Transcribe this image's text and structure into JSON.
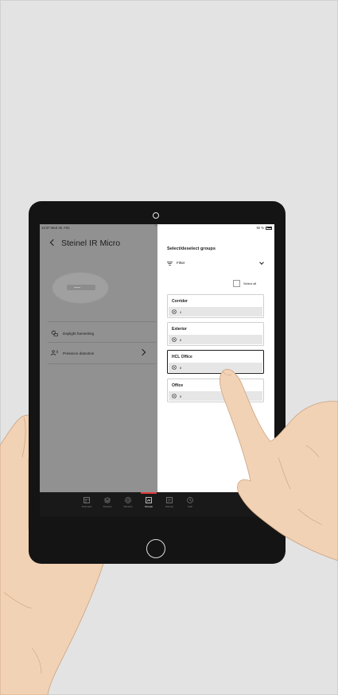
{
  "status_bar": {
    "time_date": "13:37  Wed 26. Feb",
    "battery": "92 %",
    "dots": "•••"
  },
  "left_panel": {
    "title": "Steinel IR Micro",
    "menu": [
      {
        "label": "Daylight harvesting",
        "icon": "daylight-harvesting-icon"
      },
      {
        "label": "Presence detection",
        "icon": "presence-detection-icon"
      }
    ]
  },
  "right_panel": {
    "title": "Select/deselect groups",
    "filter_label": "Filter",
    "select_all_label": "Select all",
    "groups": [
      {
        "name": "Corridor",
        "count": "4",
        "selected": false
      },
      {
        "name": "Exterior",
        "count": "8",
        "selected": false
      },
      {
        "name": "HCL Office",
        "count": "8",
        "selected": true
      },
      {
        "name": "Office",
        "count": "8",
        "selected": false
      }
    ]
  },
  "tabbar": {
    "tabs": [
      {
        "label": "Overview",
        "icon": "overview-icon"
      },
      {
        "label": "Devices",
        "icon": "devices-icon"
      },
      {
        "label": "Sensors",
        "icon": "sensors-icon"
      },
      {
        "label": "Groups",
        "icon": "groups-icon",
        "active": true
      },
      {
        "label": "Scenes",
        "icon": "scenes-icon"
      },
      {
        "label": "Auto",
        "icon": "auto-icon"
      }
    ]
  },
  "colors": {
    "accent_red": "#e23b3b",
    "dim_overlay": "#919191",
    "tabbar_bg": "#191919"
  }
}
